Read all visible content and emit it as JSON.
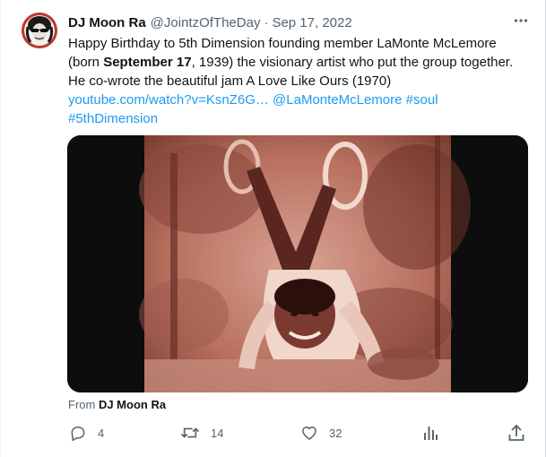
{
  "author": {
    "display_name": "DJ Moon Ra",
    "handle": "@JointzOfTheDay",
    "separator": "·",
    "date": "Sep 17, 2022"
  },
  "tweet": {
    "line1": "Happy Birthday to 5th Dimension founding member LaMonte McLemore",
    "line2_pre": "(born ",
    "line2_bold": "September 17",
    "line2_post": ", 1939) the visionary artist who put the group together.",
    "line3": "He co-wrote the beautiful jam A Love Like Ours (1970)",
    "link": "youtube.com/watch?v=KsnZ6G…",
    "mention": "@LaMonteMcLemore",
    "hashtag1": "#soul",
    "hashtag2": "#5thDimension"
  },
  "from": {
    "prefix": "From ",
    "name": "DJ Moon Ra"
  },
  "actions": {
    "replies": "4",
    "retweets": "14",
    "likes": "32"
  },
  "icons": {
    "more": "more-icon",
    "reply": "reply-icon",
    "retweet": "retweet-icon",
    "like": "like-icon",
    "views": "analytics-icon",
    "share": "share-icon"
  },
  "colors": {
    "link": "#1d9bf0",
    "secondary_text": "#536471",
    "primary_text": "#0f1419",
    "media_tint": "#c98778"
  }
}
